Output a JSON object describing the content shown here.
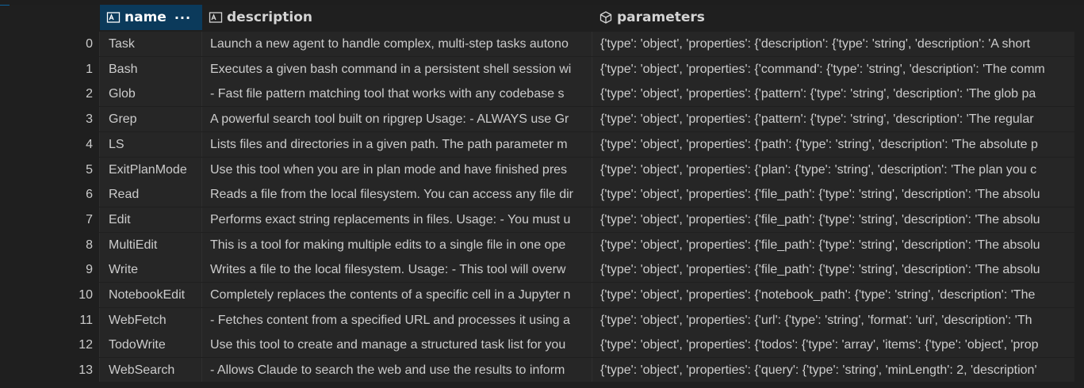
{
  "columns": {
    "name": {
      "label": "name",
      "menu": "···",
      "icon": "text-column-icon"
    },
    "description": {
      "label": "description",
      "icon": "text-column-icon"
    },
    "parameters": {
      "label": "parameters",
      "icon": "cube-icon"
    }
  },
  "colors": {
    "background": "#1f1f1f",
    "cell_background": "#262626",
    "selected_header": "#0b3a5b",
    "accent": "#0e639c"
  },
  "rows": [
    {
      "index": "0",
      "name": "Task",
      "description": "Launch a new agent to handle complex, multi-step tasks autono",
      "parameters": "{'type': 'object', 'properties': {'description': {'type': 'string', 'description': 'A short"
    },
    {
      "index": "1",
      "name": "Bash",
      "description": "Executes a given bash command in a persistent shell session wi",
      "parameters": "{'type': 'object', 'properties': {'command': {'type': 'string', 'description': 'The comm"
    },
    {
      "index": "2",
      "name": "Glob",
      "description": "- Fast file pattern matching tool that works with any codebase s",
      "parameters": "{'type': 'object', 'properties': {'pattern': {'type': 'string', 'description': 'The glob pa"
    },
    {
      "index": "3",
      "name": "Grep",
      "description": "A powerful search tool built on ripgrep Usage: - ALWAYS use Gr",
      "parameters": "{'type': 'object', 'properties': {'pattern': {'type': 'string', 'description': 'The regular"
    },
    {
      "index": "4",
      "name": "LS",
      "description": "Lists files and directories in a given path. The path parameter m",
      "parameters": "{'type': 'object', 'properties': {'path': {'type': 'string', 'description': 'The absolute p"
    },
    {
      "index": "5",
      "name": "ExitPlanMode",
      "description": "Use this tool when you are in plan mode and have finished pres",
      "parameters": "{'type': 'object', 'properties': {'plan': {'type': 'string', 'description': 'The plan you c"
    },
    {
      "index": "6",
      "name": "Read",
      "description": "Reads a file from the local filesystem. You can access any file dir",
      "parameters": "{'type': 'object', 'properties': {'file_path': {'type': 'string', 'description': 'The absolu"
    },
    {
      "index": "7",
      "name": "Edit",
      "description": "Performs exact string replacements in files. Usage: - You must u",
      "parameters": "{'type': 'object', 'properties': {'file_path': {'type': 'string', 'description': 'The absolu"
    },
    {
      "index": "8",
      "name": "MultiEdit",
      "description": "This is a tool for making multiple edits to a single file in one ope",
      "parameters": "{'type': 'object', 'properties': {'file_path': {'type': 'string', 'description': 'The absolu"
    },
    {
      "index": "9",
      "name": "Write",
      "description": "Writes a file to the local filesystem. Usage: - This tool will overw",
      "parameters": "{'type': 'object', 'properties': {'file_path': {'type': 'string', 'description': 'The absolu"
    },
    {
      "index": "10",
      "name": "NotebookEdit",
      "description": "Completely replaces the contents of a specific cell in a Jupyter n",
      "parameters": "{'type': 'object', 'properties': {'notebook_path': {'type': 'string', 'description': 'The"
    },
    {
      "index": "11",
      "name": "WebFetch",
      "description": "- Fetches content from a specified URL and processes it using a",
      "parameters": "{'type': 'object', 'properties': {'url': {'type': 'string', 'format': 'uri', 'description': 'Th"
    },
    {
      "index": "12",
      "name": "TodoWrite",
      "description": "Use this tool to create and manage a structured task list for you",
      "parameters": "{'type': 'object', 'properties': {'todos': {'type': 'array', 'items': {'type': 'object', 'prop"
    },
    {
      "index": "13",
      "name": "WebSearch",
      "description": "- Allows Claude to search the web and use the results to inform",
      "parameters": "{'type': 'object', 'properties': {'query': {'type': 'string', 'minLength': 2, 'description'"
    }
  ]
}
